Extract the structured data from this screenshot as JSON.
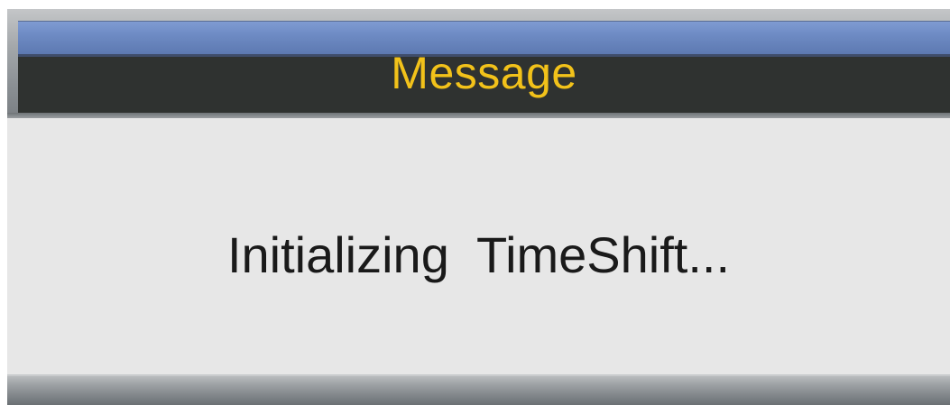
{
  "dialog": {
    "title": "Message",
    "message": "Initializing  TimeShift..."
  },
  "colors": {
    "title_text": "#f2c21a",
    "title_band": "#6e8bc4",
    "title_bg": "#2f3230",
    "body_bg": "#e7e7e7",
    "message_text": "#1a1a1a"
  }
}
